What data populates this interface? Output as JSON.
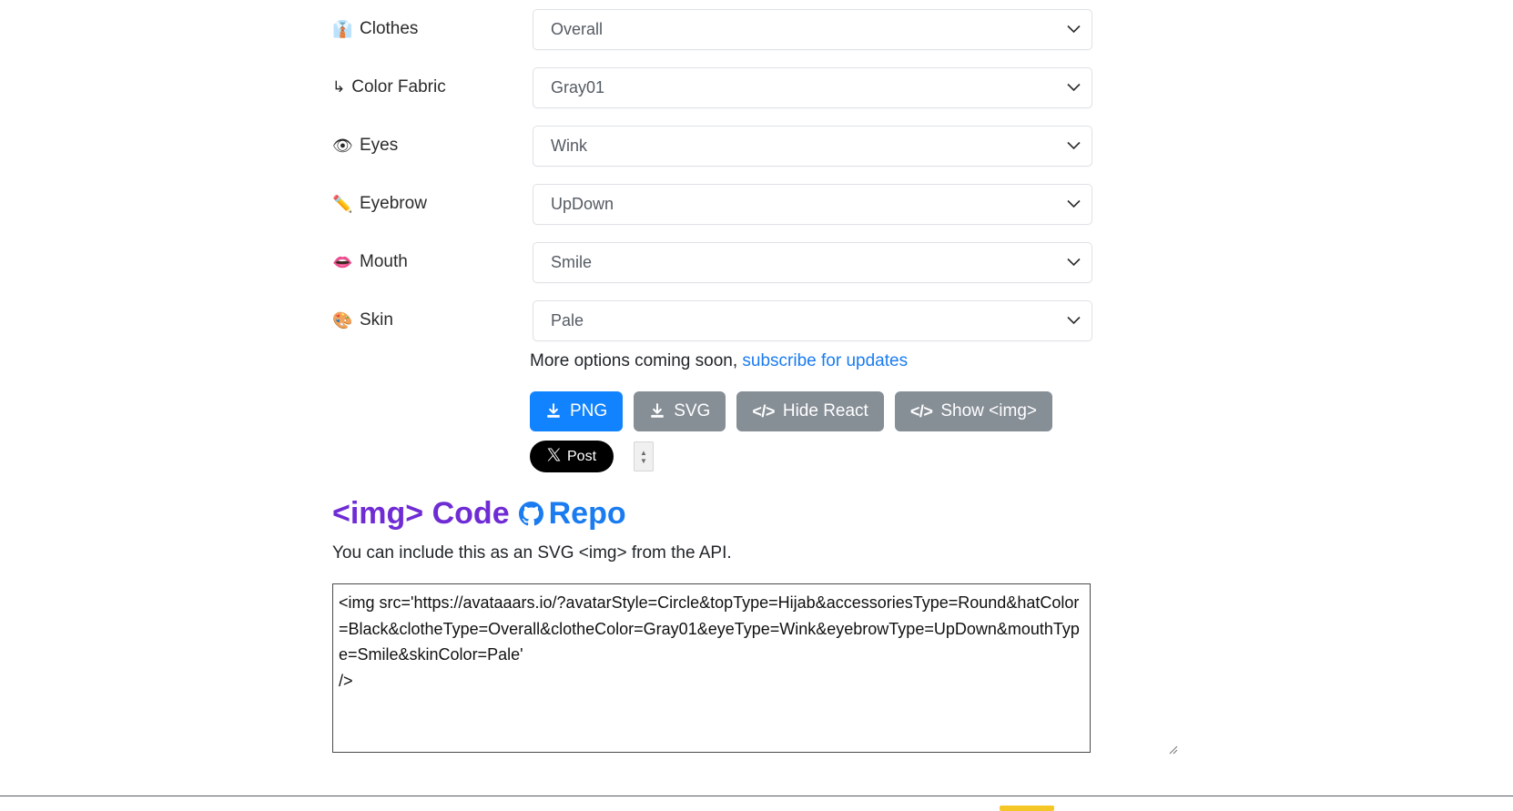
{
  "options": [
    {
      "icon": "👔",
      "icon_name": "clothes-icon",
      "label": "Clothes",
      "value": "Overall",
      "field": "clothes"
    },
    {
      "icon": "↳",
      "icon_name": "sub-arrow-icon",
      "label": "Color Fabric",
      "value": "Gray01",
      "field": "color-fabric"
    },
    {
      "icon": "👁",
      "icon_name": "eye-icon",
      "label": "Eyes",
      "value": "Wink",
      "field": "eyes"
    },
    {
      "icon": "✏️",
      "icon_name": "pencil-icon",
      "label": "Eyebrow",
      "value": "UpDown",
      "field": "eyebrow"
    },
    {
      "icon": "👄",
      "icon_name": "mouth-icon",
      "label": "Mouth",
      "value": "Smile",
      "field": "mouth"
    },
    {
      "icon": "🎨",
      "icon_name": "palette-icon",
      "label": "Skin",
      "value": "Pale",
      "field": "skin"
    }
  ],
  "more_options": {
    "text": "More options coming soon,",
    "link_label": "subscribe for updates",
    "link_color": "#1a7cf0"
  },
  "buttons": {
    "png": "PNG",
    "svg": "SVG",
    "hide_react": "Hide React",
    "show_img": "Show <img>",
    "code_glyph": "</>",
    "primary_color": "#1283ff",
    "secondary_color": "#868e96"
  },
  "social": {
    "post_label": "Post",
    "x_glyph": "𝕏"
  },
  "section": {
    "heading_code": "<img> Code",
    "heading_repo": "Repo",
    "heading_code_color": "#6f2cd4",
    "heading_repo_color": "#1a7cf0",
    "description": "You can include this as an SVG <img> from the API."
  },
  "code_snippet": {
    "value": "<img src='https://avataaars.io/?avatarStyle=Circle&topType=Hijab&accessoriesType=Round&hatColor=Black&clotheType=Overall&clotheColor=Gray01&eyeType=Wink&eyebrowType=UpDown&mouthType=Smile&skinColor=Pale'\n/>"
  }
}
